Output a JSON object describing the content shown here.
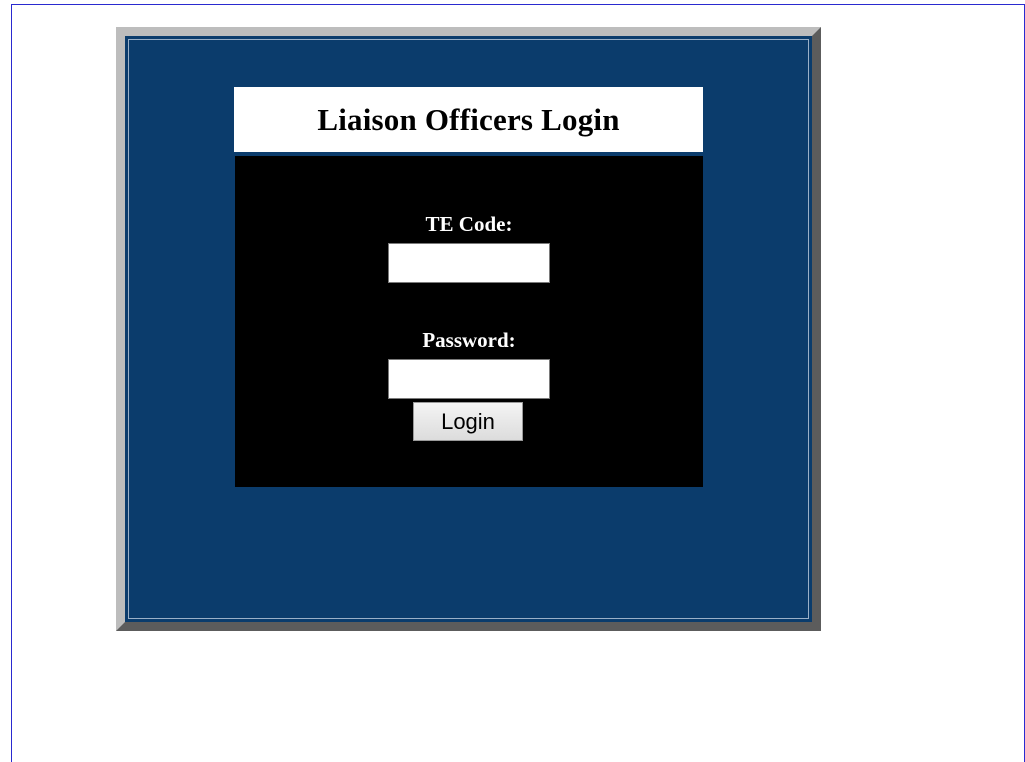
{
  "login": {
    "title": "Liaison Officers Login",
    "te_code_label": "TE Code:",
    "te_code_value": "",
    "password_label": "Password:",
    "password_value": "",
    "button_label": "Login"
  },
  "colors": {
    "panel_background": "#0b3c6c",
    "form_background": "#000000",
    "title_background": "#ffffff"
  }
}
